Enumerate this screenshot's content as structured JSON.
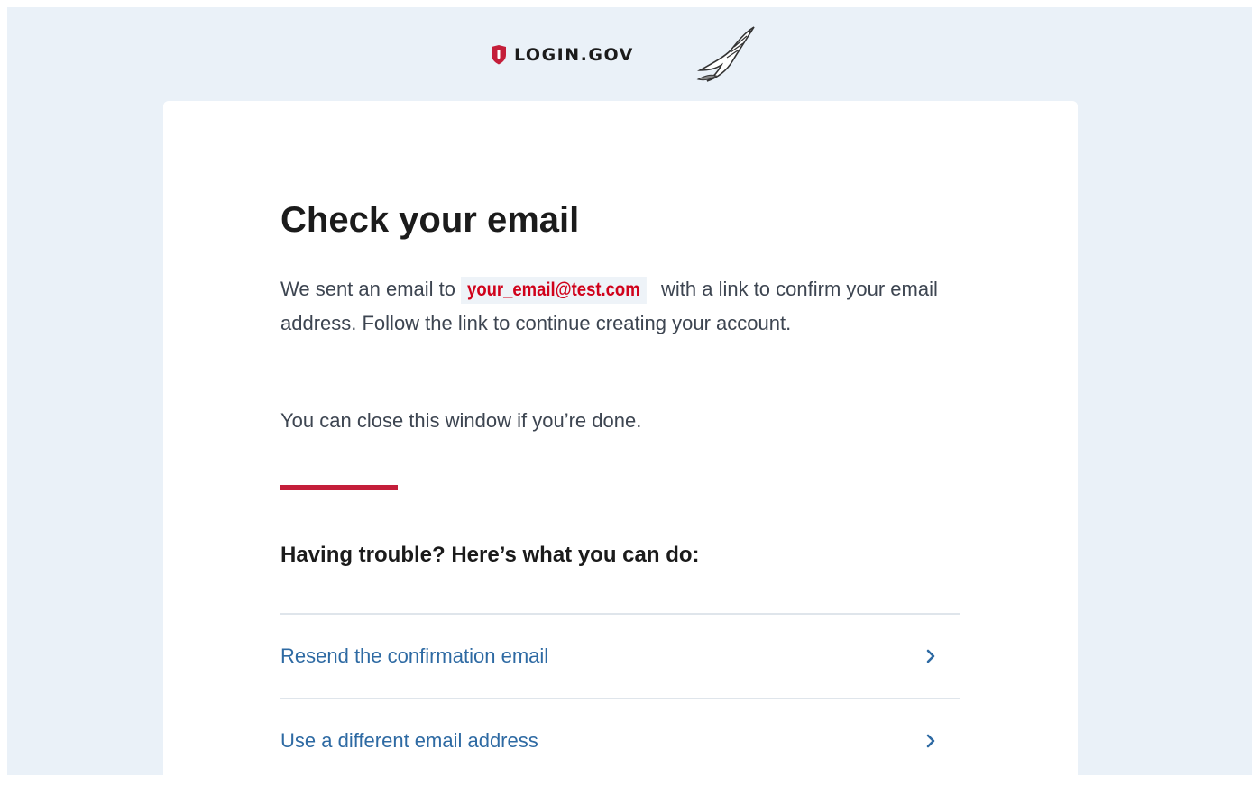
{
  "header": {
    "brand_text": "LOGIN.GOV",
    "brand_color": "#c41e3a",
    "brand_icon": "shield-icon",
    "agency_logo": "eagle-icon"
  },
  "main": {
    "title": "Check your email",
    "intro_before": "We sent an email to ",
    "email": "your_email@test.com",
    "intro_after": " with a link to confirm your email address. Follow the link to continue creating your account.",
    "close_note": "You can close this window if you’re done.",
    "trouble_heading": "Having trouble? Here’s what you can do:",
    "options": [
      {
        "label": "Resend the confirmation email",
        "icon": "chevron-right-icon"
      },
      {
        "label": "Use a different email address",
        "icon": "chevron-right-icon"
      }
    ]
  },
  "colors": {
    "page_background": "#eaf1f8",
    "accent": "#c41e3a",
    "link": "#2e6aa3",
    "email_highlight": "#d0021b"
  }
}
